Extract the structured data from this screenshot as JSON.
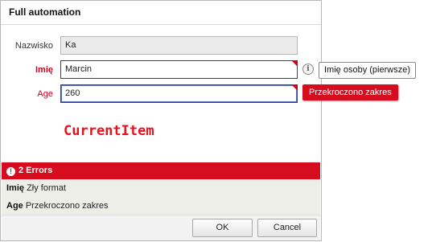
{
  "window": {
    "title": "Full automation"
  },
  "form": {
    "nazwisko": {
      "label": "Nazwisko",
      "value": "Ka"
    },
    "imie": {
      "label": "Imię",
      "value": "Marcin",
      "tooltip": "Imię osoby (pierwsze)"
    },
    "age": {
      "label": "Age",
      "value": "260",
      "error_tooltip": "Przekroczono zakres"
    }
  },
  "current_item": "CurrentItem",
  "errors": {
    "header": "2 Errors",
    "items": [
      {
        "field": "Imię",
        "message": "Zły format"
      },
      {
        "field": "Age",
        "message": "Przekroczono zakres"
      }
    ]
  },
  "buttons": {
    "ok": "OK",
    "cancel": "Cancel"
  },
  "colors": {
    "error": "#d50d1e",
    "current_item": "#e3141e"
  },
  "icons": {
    "info": "info-icon",
    "error": "error-circle-icon"
  }
}
